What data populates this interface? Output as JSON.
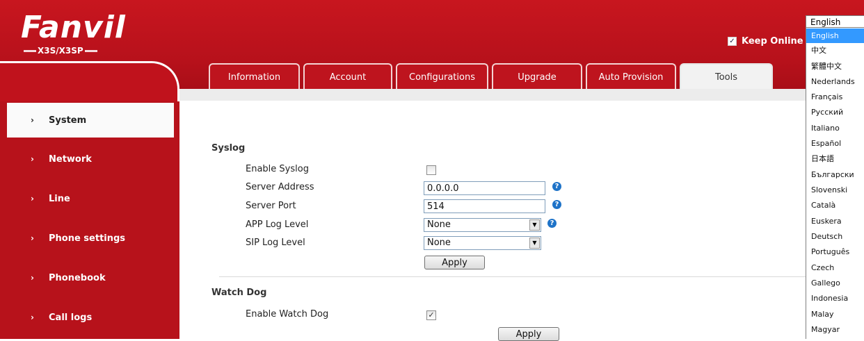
{
  "brand": {
    "logo_text": "Fanvil",
    "model": "X3S/X3SP"
  },
  "header": {
    "keep_online_label": "Keep Online",
    "keep_online_checked": true
  },
  "sidebar": {
    "items": [
      {
        "label": "System",
        "active": true
      },
      {
        "label": "Network"
      },
      {
        "label": "Line"
      },
      {
        "label": "Phone settings"
      },
      {
        "label": "Phonebook"
      },
      {
        "label": "Call logs"
      }
    ]
  },
  "tabs": [
    {
      "label": "Information"
    },
    {
      "label": "Account"
    },
    {
      "label": "Configurations"
    },
    {
      "label": "Upgrade"
    },
    {
      "label": "Auto Provision"
    },
    {
      "label": "Tools",
      "active": true
    }
  ],
  "syslog": {
    "title": "Syslog",
    "enable_label": "Enable Syslog",
    "enable_checked": false,
    "server_address_label": "Server Address",
    "server_address_value": "0.0.0.0",
    "server_port_label": "Server Port",
    "server_port_value": "514",
    "app_log_level_label": "APP Log Level",
    "app_log_level_value": "None",
    "sip_log_level_label": "SIP Log Level",
    "sip_log_level_value": "None",
    "apply_label": "Apply"
  },
  "watchdog": {
    "title": "Watch Dog",
    "enable_label": "Enable Watch Dog",
    "enable_checked": true,
    "apply_label": "Apply"
  },
  "language": {
    "current": "English",
    "options": [
      "English",
      "中文",
      "繁體中文",
      "Nederlands",
      "Français",
      "Русский",
      "Italiano",
      "Español",
      "日本語",
      "Български",
      "Slovenski",
      "Català",
      "Euskera",
      "Deutsch",
      "Português",
      "Czech",
      "Gallego",
      "Indonesia",
      "Malay",
      "Magyar"
    ],
    "selected": "English"
  },
  "colors": {
    "brand_red": "#be141e",
    "selection_blue": "#3399ff",
    "help_blue": "#1e73c8"
  }
}
